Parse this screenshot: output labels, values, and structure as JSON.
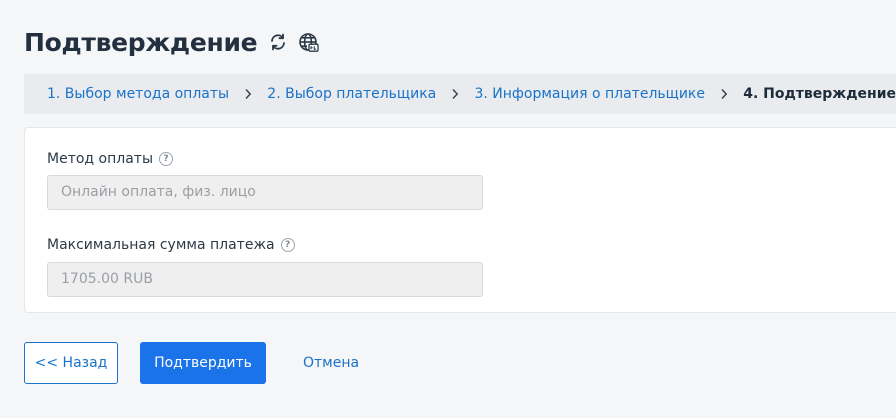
{
  "header": {
    "title": "Подтверждение",
    "icons": [
      "refresh-icon",
      "globe-icon"
    ]
  },
  "steps": [
    {
      "label": "1. Выбор метода оплаты",
      "state": "link"
    },
    {
      "label": "2. Выбор плательщика",
      "state": "link"
    },
    {
      "label": "3. Информация о плательщике",
      "state": "link"
    },
    {
      "label": "4. Подтверждение",
      "state": "active"
    }
  ],
  "form": {
    "payment_method": {
      "label": "Метод оплаты",
      "value": "Онлайн оплата,  физ. лицо"
    },
    "max_amount": {
      "label": "Максимальная сумма платежа",
      "value": "1705.00 RUB"
    }
  },
  "actions": {
    "back_label": "<< Назад",
    "confirm_label": "Подтвердить",
    "cancel_label": "Отмена"
  },
  "colors": {
    "accent": "#1a73e8",
    "link": "#1a73c9",
    "background": "#f5f6f8"
  }
}
